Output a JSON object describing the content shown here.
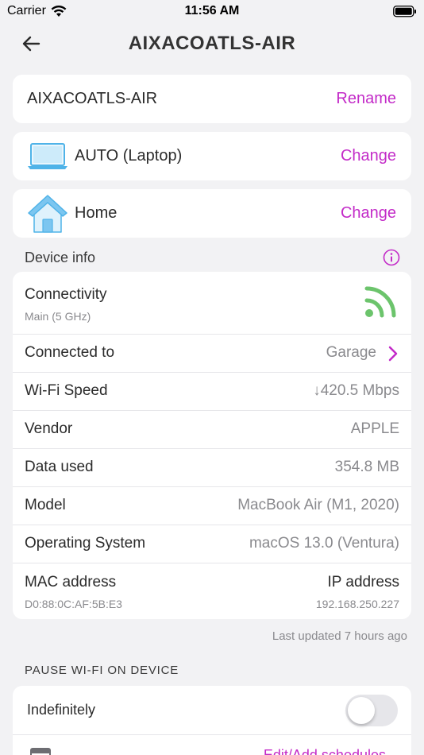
{
  "status_bar": {
    "carrier": "Carrier",
    "time": "11:56 AM"
  },
  "nav": {
    "title": "AIXACOATLS-AIR"
  },
  "name_card": {
    "name": "AIXACOATLS-AIR",
    "action": "Rename"
  },
  "type_card": {
    "label": "AUTO (Laptop)",
    "action": "Change",
    "icon": "laptop-icon"
  },
  "group_card": {
    "label": "Home",
    "action": "Change",
    "icon": "house-icon"
  },
  "device_info": {
    "heading": "Device info",
    "connectivity": {
      "label": "Connectivity",
      "sub": "Main (5 GHz)",
      "icon": "wifi-signal-icon",
      "color": "#6cc46c"
    },
    "connected_to": {
      "label": "Connected to",
      "value": "Garage"
    },
    "wifi_speed": {
      "label": "Wi-Fi Speed",
      "value": "↓420.5 Mbps"
    },
    "vendor": {
      "label": "Vendor",
      "value": "APPLE"
    },
    "data_used": {
      "label": "Data used",
      "value": "354.8 MB"
    },
    "model": {
      "label": "Model",
      "value": "MacBook Air (M1, 2020)"
    },
    "os": {
      "label": "Operating System",
      "value": "macOS 13.0 (Ventura)"
    },
    "mac": {
      "label": "MAC address",
      "value": "D0:88:0C:AF:5B:E3"
    },
    "ip": {
      "label": "IP address",
      "value": "192.168.250.227"
    }
  },
  "last_updated": "Last updated 7 hours ago",
  "pause": {
    "heading": "PAUSE WI-FI ON DEVICE",
    "indefinitely_label": "Indefinitely",
    "indefinitely_on": false,
    "schedule_label": "Edit/Add schedules"
  },
  "colors": {
    "accent": "#c32bc8",
    "background": "#f2f2f4"
  }
}
